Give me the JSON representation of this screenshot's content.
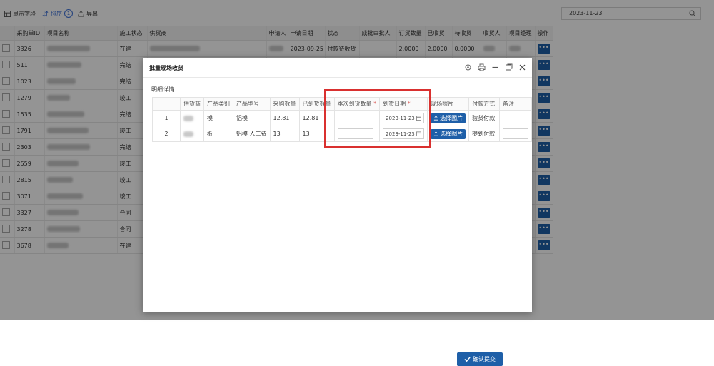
{
  "toolbar": {
    "show_fields": "显示字段",
    "sort": "排序",
    "sort_count": "1",
    "export": "导出",
    "date_value": "2023-11-23"
  },
  "main_table": {
    "headers": [
      "采购单ID",
      "项目名称",
      "施工状态",
      "供货商",
      "申请人",
      "申请日期",
      "状态",
      "成批审批人",
      "订货数量",
      "已收货",
      "待收货",
      "收货人",
      "项目经理",
      "操作"
    ],
    "rows": [
      {
        "id": "3326",
        "status": "在建",
        "date": "2023-09-25",
        "state": "付款待收货",
        "qty": "2.0000",
        "recv": "2.0000",
        "pending": "0.0000"
      },
      {
        "id": "511",
        "status": "完结"
      },
      {
        "id": "1023",
        "status": "完结"
      },
      {
        "id": "1279",
        "status": "竣工"
      },
      {
        "id": "1535",
        "status": "完结"
      },
      {
        "id": "1791",
        "status": "竣工"
      },
      {
        "id": "2303",
        "status": "完结"
      },
      {
        "id": "2559",
        "status": "竣工"
      },
      {
        "id": "2815",
        "status": "竣工"
      },
      {
        "id": "3071",
        "status": "竣工"
      },
      {
        "id": "3327",
        "status": "合同"
      },
      {
        "id": "3278",
        "status": "合同"
      },
      {
        "id": "3678",
        "status": "在建"
      }
    ],
    "op_label": "•••"
  },
  "dialog": {
    "title": "批量现场收货",
    "section": "明细详情",
    "headers": [
      "",
      "供货商",
      "产品类别",
      "产品型号",
      "采购数量",
      "已到货数量",
      "本次到货数量",
      "到货日期",
      "现场照片",
      "付款方式",
      "备注"
    ],
    "required_mark": "*",
    "rows": [
      {
        "no": "1",
        "category": "模",
        "model": "铝模",
        "qty": "12.81",
        "arrived": "12.81",
        "date": "2023-11-23",
        "photo": "选择图片",
        "payment": "验货付款"
      },
      {
        "no": "2",
        "category": "板",
        "model": "铝模 人工费",
        "qty": "13",
        "arrived": "13",
        "date": "2023-11-23",
        "photo": "选择图片",
        "payment": "提到付款"
      }
    ],
    "confirm": "确认提交"
  }
}
